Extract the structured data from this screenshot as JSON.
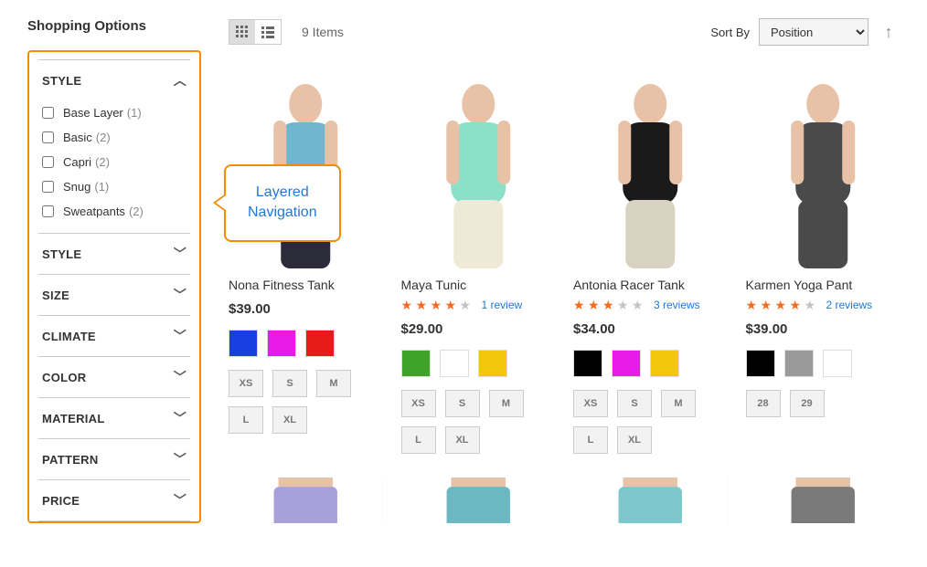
{
  "sidebar": {
    "title": "Shopping Options",
    "expandedFilter": {
      "title": "STYLE",
      "options": [
        {
          "label": "Base Layer",
          "count": 1
        },
        {
          "label": "Basic",
          "count": 2
        },
        {
          "label": "Capri",
          "count": 2
        },
        {
          "label": "Snug",
          "count": 1
        },
        {
          "label": "Sweatpants",
          "count": 2
        }
      ]
    },
    "collapsedFilters": [
      {
        "title": "STYLE"
      },
      {
        "title": "SIZE"
      },
      {
        "title": "CLIMATE"
      },
      {
        "title": "COLOR"
      },
      {
        "title": "MATERIAL"
      },
      {
        "title": "PATTERN"
      },
      {
        "title": "PRICE"
      }
    ]
  },
  "callout": {
    "line1": "Layered",
    "line2": "Navigation"
  },
  "toolbar": {
    "itemCount": "9 Items",
    "sortByLabel": "Sort By",
    "sortValue": "Position"
  },
  "products": [
    {
      "name": "Nona Fitness Tank",
      "rating": 0,
      "reviewsText": "",
      "price": "$39.00",
      "colors": [
        "#1a3fe0",
        "#e81ae8",
        "#e81a1a"
      ],
      "sizes": [
        "XS",
        "S",
        "M",
        "L",
        "XL"
      ]
    },
    {
      "name": "Maya Tunic",
      "rating": 4,
      "reviewsText": "1 review",
      "price": "$29.00",
      "colors": [
        "#3fa32a",
        "#ffffff",
        "#f3c80c"
      ],
      "sizes": [
        "XS",
        "S",
        "M",
        "L",
        "XL"
      ]
    },
    {
      "name": "Antonia Racer Tank",
      "rating": 3,
      "reviewsText": "3 reviews",
      "price": "$34.00",
      "colors": [
        "#000000",
        "#e81ae8",
        "#f3c80c"
      ],
      "sizes": [
        "XS",
        "S",
        "M",
        "L",
        "XL"
      ]
    },
    {
      "name": "Karmen Yoga Pant",
      "rating": 4,
      "reviewsText": "2 reviews",
      "price": "$39.00",
      "colors": [
        "#000000",
        "#9a9a9a",
        "#ffffff"
      ],
      "sizes": [
        "28",
        "29"
      ]
    }
  ],
  "row2Images": [
    "short-1",
    "short-2",
    "short-3",
    "short-4"
  ]
}
